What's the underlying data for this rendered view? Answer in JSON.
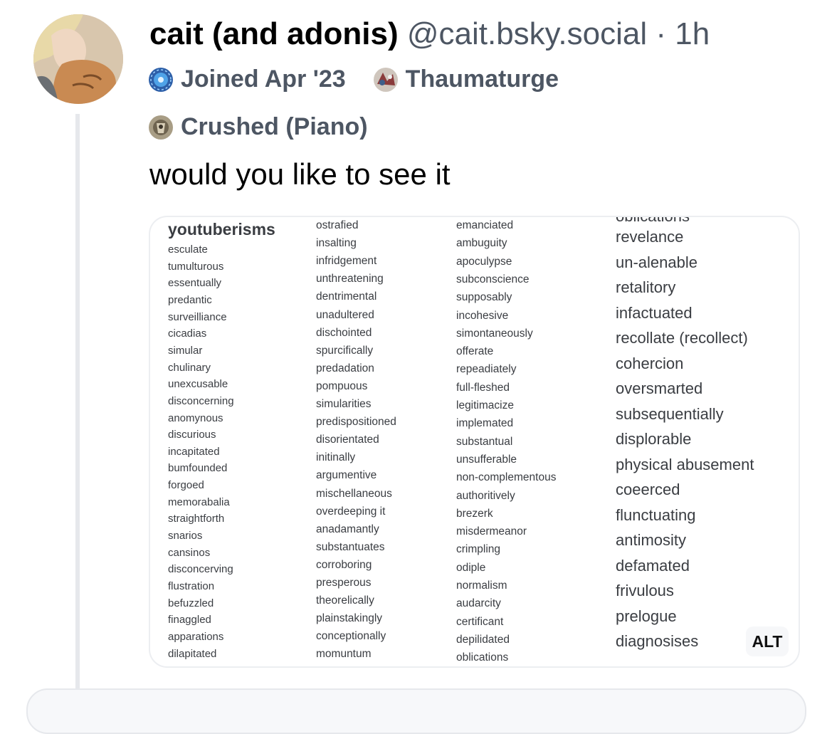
{
  "post": {
    "display_name": "cait (and adonis)",
    "handle": "@cait.bsky.social",
    "separator": "·",
    "time": "1h",
    "badges": [
      {
        "label": "Joined Apr '23",
        "icon": "globe-icon"
      },
      {
        "label": "Thaumaturge",
        "icon": "thaumaturge-icon"
      },
      {
        "label": "Crushed (Piano)",
        "icon": "piano-icon"
      }
    ],
    "text": "would you like to see it"
  },
  "image": {
    "title": "youtuberisms",
    "top_cut_word": "oblications",
    "alt_label": "ALT",
    "columns": [
      [
        "esculate",
        "tumulturous",
        "essentually",
        "predantic",
        "surveilliance",
        "cicadias",
        "simular",
        "chulinary",
        "unexcusable",
        "disconcerning",
        "anomynous",
        "discurious",
        "incapitated",
        "bumfounded",
        "forgoed",
        "memorabalia",
        "straightforth",
        "snarios",
        "cansinos",
        "disconcerving",
        "flustration",
        "befuzzled",
        "finaggled",
        "apparations",
        "dilapitated"
      ],
      [
        "ostrafied",
        "insalting",
        "infridgement",
        "unthreatening",
        "dentrimental",
        "unadultered",
        "dischointed",
        "spurcifically",
        "predadation",
        "pompuous",
        "simularities",
        "predispositioned",
        "disorientated",
        "initinally",
        "argumentive",
        "mischellaneous",
        "overdeeping it",
        "anadamantly",
        "substantuates",
        "corroboring",
        "presperous",
        "theorelically",
        "plainstakingly",
        "conceptionally",
        "momuntum"
      ],
      [
        "emanciated",
        "ambuguity",
        "apoculypse",
        "subconscience",
        "supposably",
        "incohesive",
        "simontaneously",
        "offerate",
        "repeadiately",
        "full-fleshed",
        "legitimacize",
        "implemated",
        "substantual",
        "unsufferable",
        "non-complementous",
        "authoritively",
        "brezerk",
        "misdermeanor",
        "crimpling",
        "odiple",
        "normalism",
        "audarcity",
        "certificant",
        "depilidated",
        "oblications"
      ],
      [
        "revelance",
        "un-alenable",
        "retalitory",
        "infactuated",
        "recollate (recollect)",
        "cohercion",
        "oversmarted",
        "subsequentially",
        "displorable",
        "physical abusement",
        "coeerced",
        "flunctuating",
        "antimosity",
        "defamated",
        "frivulous",
        "prelogue",
        "diagnosises"
      ]
    ]
  }
}
